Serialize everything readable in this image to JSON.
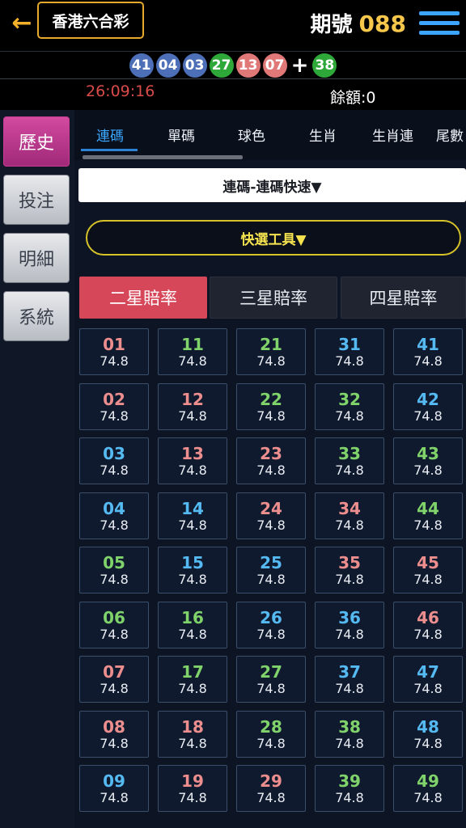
{
  "header": {
    "back_icon": "arrow-left-icon",
    "game_title": "香港六合彩",
    "period_label": "期號",
    "period_number": "088",
    "menu_icon": "hamburger-menu-icon"
  },
  "results": {
    "balls": [
      {
        "number": "41",
        "color": "blue"
      },
      {
        "number": "04",
        "color": "blue"
      },
      {
        "number": "03",
        "color": "blue"
      },
      {
        "number": "27",
        "color": "green"
      },
      {
        "number": "13",
        "color": "red"
      },
      {
        "number": "07",
        "color": "red"
      }
    ],
    "plus": "+",
    "special": {
      "number": "38",
      "color": "green"
    }
  },
  "info": {
    "timer": "26:09:16",
    "balance_label": "餘額:",
    "balance_value": "0"
  },
  "sidebar": {
    "items": [
      {
        "label": "歷史",
        "active": true
      },
      {
        "label": "投注",
        "active": false
      },
      {
        "label": "明細",
        "active": false
      },
      {
        "label": "系統",
        "active": false
      }
    ]
  },
  "tabs": [
    {
      "label": "連碼",
      "active": true
    },
    {
      "label": "單碼",
      "active": false
    },
    {
      "label": "球色",
      "active": false
    },
    {
      "label": "生肖",
      "active": false
    },
    {
      "label": "生肖連",
      "active": false
    },
    {
      "label": "尾數",
      "active": false
    }
  ],
  "subtitle": "連碼-連碼快速▼",
  "quick_tool": "快選工具▼",
  "odds_tabs": [
    {
      "label": "二星賠率",
      "active": true
    },
    {
      "label": "三星賠率",
      "active": false
    },
    {
      "label": "四星賠率",
      "active": false
    }
  ],
  "colors": {
    "accent_blue": "#3aa7ff",
    "active_red": "#d6475a",
    "sidebar_active": "#c0378f",
    "gold": "#f6c74a",
    "num_red": "#ec8e8e",
    "num_blue": "#55b9f2",
    "num_green": "#7fd36a"
  },
  "grid": {
    "cells": [
      {
        "num": "01",
        "color": "red",
        "odd": "74.8"
      },
      {
        "num": "11",
        "color": "green",
        "odd": "74.8"
      },
      {
        "num": "21",
        "color": "green",
        "odd": "74.8"
      },
      {
        "num": "31",
        "color": "blue",
        "odd": "74.8"
      },
      {
        "num": "41",
        "color": "blue",
        "odd": "74.8"
      },
      {
        "num": "02",
        "color": "red",
        "odd": "74.8"
      },
      {
        "num": "12",
        "color": "red",
        "odd": "74.8"
      },
      {
        "num": "22",
        "color": "green",
        "odd": "74.8"
      },
      {
        "num": "32",
        "color": "green",
        "odd": "74.8"
      },
      {
        "num": "42",
        "color": "blue",
        "odd": "74.8"
      },
      {
        "num": "03",
        "color": "blue",
        "odd": "74.8"
      },
      {
        "num": "13",
        "color": "red",
        "odd": "74.8"
      },
      {
        "num": "23",
        "color": "red",
        "odd": "74.8"
      },
      {
        "num": "33",
        "color": "green",
        "odd": "74.8"
      },
      {
        "num": "43",
        "color": "green",
        "odd": "74.8"
      },
      {
        "num": "04",
        "color": "blue",
        "odd": "74.8"
      },
      {
        "num": "14",
        "color": "blue",
        "odd": "74.8"
      },
      {
        "num": "24",
        "color": "red",
        "odd": "74.8"
      },
      {
        "num": "34",
        "color": "red",
        "odd": "74.8"
      },
      {
        "num": "44",
        "color": "green",
        "odd": "74.8"
      },
      {
        "num": "05",
        "color": "green",
        "odd": "74.8"
      },
      {
        "num": "15",
        "color": "blue",
        "odd": "74.8"
      },
      {
        "num": "25",
        "color": "blue",
        "odd": "74.8"
      },
      {
        "num": "35",
        "color": "red",
        "odd": "74.8"
      },
      {
        "num": "45",
        "color": "red",
        "odd": "74.8"
      },
      {
        "num": "06",
        "color": "green",
        "odd": "74.8"
      },
      {
        "num": "16",
        "color": "green",
        "odd": "74.8"
      },
      {
        "num": "26",
        "color": "blue",
        "odd": "74.8"
      },
      {
        "num": "36",
        "color": "blue",
        "odd": "74.8"
      },
      {
        "num": "46",
        "color": "red",
        "odd": "74.8"
      },
      {
        "num": "07",
        "color": "red",
        "odd": "74.8"
      },
      {
        "num": "17",
        "color": "green",
        "odd": "74.8"
      },
      {
        "num": "27",
        "color": "green",
        "odd": "74.8"
      },
      {
        "num": "37",
        "color": "blue",
        "odd": "74.8"
      },
      {
        "num": "47",
        "color": "blue",
        "odd": "74.8"
      },
      {
        "num": "08",
        "color": "red",
        "odd": "74.8"
      },
      {
        "num": "18",
        "color": "red",
        "odd": "74.8"
      },
      {
        "num": "28",
        "color": "green",
        "odd": "74.8"
      },
      {
        "num": "38",
        "color": "green",
        "odd": "74.8"
      },
      {
        "num": "48",
        "color": "blue",
        "odd": "74.8"
      },
      {
        "num": "09",
        "color": "blue",
        "odd": "74.8"
      },
      {
        "num": "19",
        "color": "red",
        "odd": "74.8"
      },
      {
        "num": "29",
        "color": "red",
        "odd": "74.8"
      },
      {
        "num": "39",
        "color": "green",
        "odd": "74.8"
      },
      {
        "num": "49",
        "color": "green",
        "odd": "74.8"
      }
    ]
  }
}
